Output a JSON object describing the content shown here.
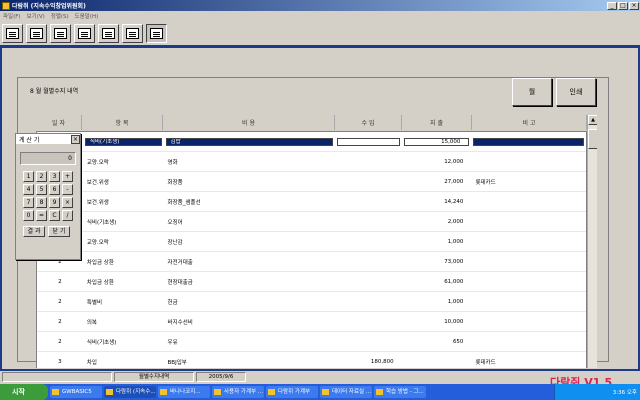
{
  "window": {
    "title": "다람쥐 (지속수익창업위원회)",
    "btn_min": "_",
    "btn_max": "□",
    "btn_close": "×"
  },
  "menu": [
    "파일(F)",
    "보기(V)",
    "정렬(S)",
    "도움말(H)"
  ],
  "toolbar": [
    "tool-1",
    "tool-2",
    "tool-3",
    "tool-4",
    "tool-5",
    "tool-6",
    "tool-7"
  ],
  "panel": {
    "heading": "8 월  월별수지 내역",
    "btn_month": "월",
    "btn_print": "인쇄"
  },
  "table": {
    "headers": [
      "일 자",
      "항 목",
      "비 용",
      "수 입",
      "지 출",
      "비 고"
    ],
    "rows": [
      {
        "day": "",
        "item": "식비(기초생)",
        "cost": "김밥",
        "income": "",
        "expense": "15,000",
        "note": ""
      },
      {
        "day": "",
        "item": "교양.오락",
        "cost": "영화",
        "income": "",
        "expense": "12,000",
        "note": ""
      },
      {
        "day": "",
        "item": "보건.위생",
        "cost": "화장품",
        "income": "",
        "expense": "27,000",
        "note": "롯데카드"
      },
      {
        "day": "",
        "item": "보건.위생",
        "cost": "화장품_샘플선",
        "income": "",
        "expense": "14,240",
        "note": ""
      },
      {
        "day": "",
        "item": "식비(기초생)",
        "cost": "오징어",
        "income": "",
        "expense": "2,000",
        "note": ""
      },
      {
        "day": "2",
        "item": "교양.오락",
        "cost": "장난감",
        "income": "",
        "expense": "1,000",
        "note": ""
      },
      {
        "day": "2",
        "item": "차입금 상환",
        "cost": "자전거대출",
        "income": "",
        "expense": "73,000",
        "note": ""
      },
      {
        "day": "2",
        "item": "차입금 상환",
        "cost": "현장대출금",
        "income": "",
        "expense": "61,000",
        "note": ""
      },
      {
        "day": "2",
        "item": "특별비",
        "cost": "헌금",
        "income": "",
        "expense": "1,000",
        "note": ""
      },
      {
        "day": "2",
        "item": "의복",
        "cost": "바지수선비",
        "income": "",
        "expense": "10,000",
        "note": ""
      },
      {
        "day": "2",
        "item": "식비(기초생)",
        "cost": "우유",
        "income": "",
        "expense": "650",
        "note": ""
      },
      {
        "day": "3",
        "item": "차입",
        "cost": "BBJ입부",
        "income": "180,800",
        "expense": "",
        "note": "롯데카드"
      }
    ]
  },
  "calculator": {
    "title": "계 산 기",
    "close": "×",
    "display": "0",
    "keys": [
      "1",
      "2",
      "3",
      "+",
      "4",
      "5",
      "6",
      "-",
      "7",
      "8",
      "9",
      "×",
      "0",
      "=",
      "C",
      "/"
    ],
    "btn_clear": "결 과",
    "btn_close": "닫 기"
  },
  "status": {
    "cell1": "",
    "cell2": "월별수지내역",
    "cell3": "2005/9/6",
    "version": "다람쥐 V1.5"
  },
  "taskbar": {
    "start": "시작",
    "tasks": [
      "GWBASIC5",
      "다람쥐 (지속수...",
      "바나나코지...",
      "사용자 가계부 ...",
      "다람쥐 가계부",
      "데이터 자료실 ...",
      "학습 방법 - 그..."
    ],
    "tray": "3:36 오후"
  },
  "colors": {
    "title_bar": "#0a246a",
    "frame": "#1c3a8a",
    "selection": "#0a246a",
    "version": "#e0204e",
    "taskbar": "#245edb"
  }
}
